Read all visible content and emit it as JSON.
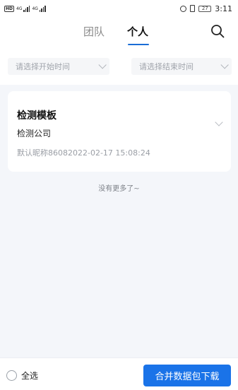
{
  "status_bar": {
    "network_badge": "HD",
    "signal1": "4G",
    "signal2": "4G",
    "battery": "27",
    "time": "3:11"
  },
  "header": {
    "tabs": [
      {
        "label": "团队",
        "active": false
      },
      {
        "label": "个人",
        "active": true
      }
    ],
    "search_icon": "search-icon",
    "accent_color": "#1a6dd6"
  },
  "filters": {
    "start_placeholder": "请选择开始时间",
    "end_placeholder": "请选择结束时间"
  },
  "records": [
    {
      "title": "检测模板",
      "company": "检测公司",
      "meta": "默认昵称86082022-02-17 15:08:24"
    }
  ],
  "list_footer": "没有更多了~",
  "bottom_bar": {
    "select_all_label": "全选",
    "download_label": "合并数据包下载",
    "button_color": "#1a73e8"
  }
}
